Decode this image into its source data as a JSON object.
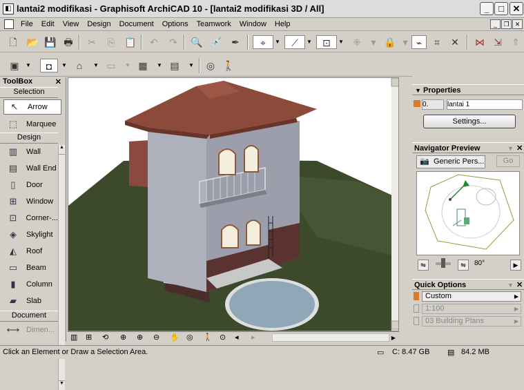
{
  "window": {
    "title": "lantai2 modifikasi - Graphisoft ArchiCAD 10 - [lantai2 modifikasi 3D / All]",
    "app_icon": "archicad-icon",
    "minimize": "_",
    "maximize": "□",
    "close": "✕"
  },
  "menu": {
    "items": [
      "File",
      "Edit",
      "View",
      "Design",
      "Document",
      "Options",
      "Teamwork",
      "Window",
      "Help"
    ],
    "doc_minimize": "_",
    "doc_restore": "❐",
    "doc_close": "✕"
  },
  "toolbox": {
    "title": "ToolBox",
    "close": "✕",
    "sections": {
      "selection": "Selection",
      "design": "Design",
      "document": "Document"
    },
    "selection_tools": [
      {
        "label": "Arrow",
        "icon": "arrow-icon",
        "glyph": "↖"
      },
      {
        "label": "Marquee",
        "icon": "marquee-icon",
        "glyph": "⬚"
      }
    ],
    "design_tools": [
      {
        "label": "Wall",
        "icon": "wall-icon",
        "glyph": "▥"
      },
      {
        "label": "Wall End",
        "icon": "wall-end-icon",
        "glyph": "▤"
      },
      {
        "label": "Door",
        "icon": "door-icon",
        "glyph": "▯"
      },
      {
        "label": "Window",
        "icon": "window-icon",
        "glyph": "⊞"
      },
      {
        "label": "Corner-...",
        "icon": "corner-window-icon",
        "glyph": "⊡"
      },
      {
        "label": "Skylight",
        "icon": "skylight-icon",
        "glyph": "◈"
      },
      {
        "label": "Roof",
        "icon": "roof-icon",
        "glyph": "◭"
      },
      {
        "label": "Beam",
        "icon": "beam-icon",
        "glyph": "▭"
      },
      {
        "label": "Column",
        "icon": "column-icon",
        "glyph": "▮"
      },
      {
        "label": "Slab",
        "icon": "slab-icon",
        "glyph": "▰"
      }
    ],
    "document_tools": [
      {
        "label": "Dimen...",
        "icon": "dimension-icon",
        "glyph": "⟷"
      }
    ]
  },
  "properties": {
    "title": "Properties",
    "layer_value": "0.",
    "story_name": "lantai 1",
    "settings_label": "Settings..."
  },
  "navigator": {
    "title": "Navigator Preview",
    "view_name": "Generic Pers...",
    "go_label": "Go",
    "angle": "80°",
    "go_icon": "go-icon",
    "close": "✕"
  },
  "quick_options": {
    "title": "Quick Options",
    "custom": "Custom",
    "scale": "1:100",
    "layer_combination": "03 Building Plans",
    "close": "✕"
  },
  "status": {
    "message": "Click an Element or Draw a Selection Area.",
    "disk": "C: 8.47 GB",
    "memory": "84.2 MB"
  },
  "colors": {
    "roof": "#8b4a3a",
    "wall": "#a8a8b4",
    "grass": "#3a4a2a",
    "pool": "#8fa7b7",
    "brick": "#5a3230"
  }
}
